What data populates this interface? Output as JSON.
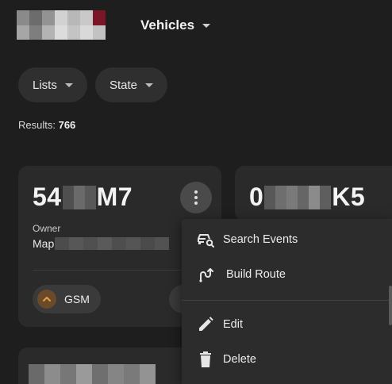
{
  "header": {
    "logo_tiles": [
      "#8a8a8a",
      "#6c6c6c",
      "#939393",
      "#d2d2d2",
      "#b8b8b8",
      "#c9c9c9",
      "#7b1626",
      "#a6a6a6",
      "#7e7e7e",
      "#b3b3b3",
      "#dcdcdc",
      "#c4c4c4",
      "#d9d9d9",
      "#c2c2c2"
    ],
    "nav_title": "Vehicles"
  },
  "filters": {
    "lists_label": "Lists",
    "state_label": "State"
  },
  "results": {
    "label": "Results:",
    "count": "766"
  },
  "card_primary": {
    "plate_prefix": "54",
    "plate_suffix": "M7",
    "plate_redaction_tiles": [
      "#4f4f4f",
      "#6a6a6a",
      "#585858"
    ],
    "owner_label": "Owner",
    "owner_value_prefix": "Map",
    "owner_redaction_tiles": [
      "#4c4c4c",
      "#575757",
      "#505050",
      "#5a5a5a",
      "#4e4e4e",
      "#555555",
      "#4b4b4b",
      "#525252"
    ],
    "tracker_label": "GSM"
  },
  "card_secondary": {
    "plate_prefix": "0",
    "plate_suffix": "K5",
    "plate_redaction_tiles": [
      "#585858",
      "#6e6e6e",
      "#7a7a7a",
      "#666666",
      "#8b8b8b",
      "#5e5e5e"
    ]
  },
  "card_tertiary": {
    "redaction_tiles": [
      "#6a6a6a",
      "#8c8c8c",
      "#777777",
      "#9a9a9a",
      "#6f6f6f",
      "#858585",
      "#7a7a7a",
      "#939393"
    ]
  },
  "context_menu": {
    "search_events_label": "Search Events",
    "build_route_label": "Build Route",
    "edit_label": "Edit",
    "delete_label": "Delete"
  },
  "colors": {
    "background": "#1e1e1e",
    "card": "#2a2a2a",
    "menu": "#2c2c2c",
    "gsm_icon_accent": "#e6a04a"
  }
}
